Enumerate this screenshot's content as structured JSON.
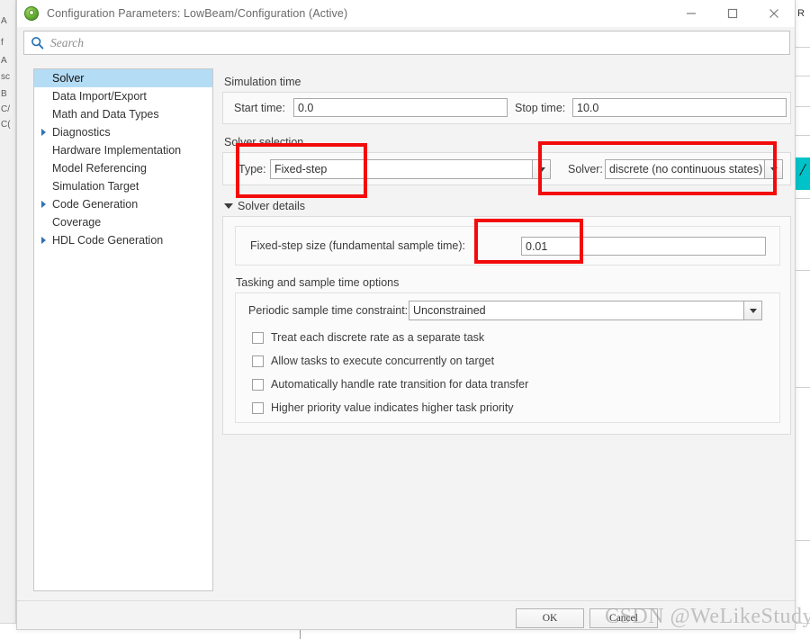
{
  "window": {
    "title": "Configuration Parameters: LowBeam/Configuration (Active)",
    "icon": "simulink-icon",
    "minimize_label": "Minimize",
    "maximize_label": "Maximize",
    "close_label": "Close"
  },
  "search": {
    "placeholder": "Search",
    "value": "",
    "icon": "search-icon"
  },
  "tree": {
    "items": [
      {
        "label": "Solver",
        "expandable": false,
        "selected": true
      },
      {
        "label": "Data Import/Export",
        "expandable": false,
        "selected": false
      },
      {
        "label": "Math and Data Types",
        "expandable": false,
        "selected": false
      },
      {
        "label": "Diagnostics",
        "expandable": true,
        "selected": false
      },
      {
        "label": "Hardware Implementation",
        "expandable": false,
        "selected": false
      },
      {
        "label": "Model Referencing",
        "expandable": false,
        "selected": false
      },
      {
        "label": "Simulation Target",
        "expandable": false,
        "selected": false
      },
      {
        "label": "Code Generation",
        "expandable": true,
        "selected": false
      },
      {
        "label": "Coverage",
        "expandable": false,
        "selected": false
      },
      {
        "label": "HDL Code Generation",
        "expandable": true,
        "selected": false
      }
    ]
  },
  "simulation_time": {
    "group_label": "Simulation time",
    "start_time_label": "Start time:",
    "start_time_value": "0.0",
    "stop_time_label": "Stop time:",
    "stop_time_value": "10.0"
  },
  "solver_selection": {
    "group_label": "Solver selection",
    "type_label": "Type:",
    "type_value": "Fixed-step",
    "solver_label": "Solver:",
    "solver_value": "discrete (no continuous states)"
  },
  "solver_details": {
    "header_label": "Solver details",
    "fixed_step_label": "Fixed-step size (fundamental sample time):",
    "fixed_step_value": "0.01",
    "tasking_label": "Tasking and sample time options",
    "periodic_label": "Periodic sample time constraint:",
    "periodic_value": "Unconstrained",
    "checkboxes": [
      {
        "label": "Treat each discrete rate as a separate task",
        "checked": false
      },
      {
        "label": "Allow tasks to execute concurrently on target",
        "checked": false
      },
      {
        "label": "Automatically handle rate transition for data transfer",
        "checked": false
      },
      {
        "label": "Higher priority value indicates higher task priority",
        "checked": false
      }
    ]
  },
  "footer": {
    "ok_label": "OK",
    "cancel_label": "Cancel"
  },
  "annotations": {
    "color": "#f30a0a",
    "boxes": [
      "solver-type-highlight",
      "solver-choice-highlight",
      "fixed-step-size-highlight"
    ]
  },
  "watermark": {
    "text": "CSDN @WeLikeStudy"
  },
  "background": {
    "left_glyphs": [
      "A",
      "f",
      "A",
      "sc",
      "B",
      "C/",
      "C(",
      ""
    ],
    "right_letter": "R"
  }
}
